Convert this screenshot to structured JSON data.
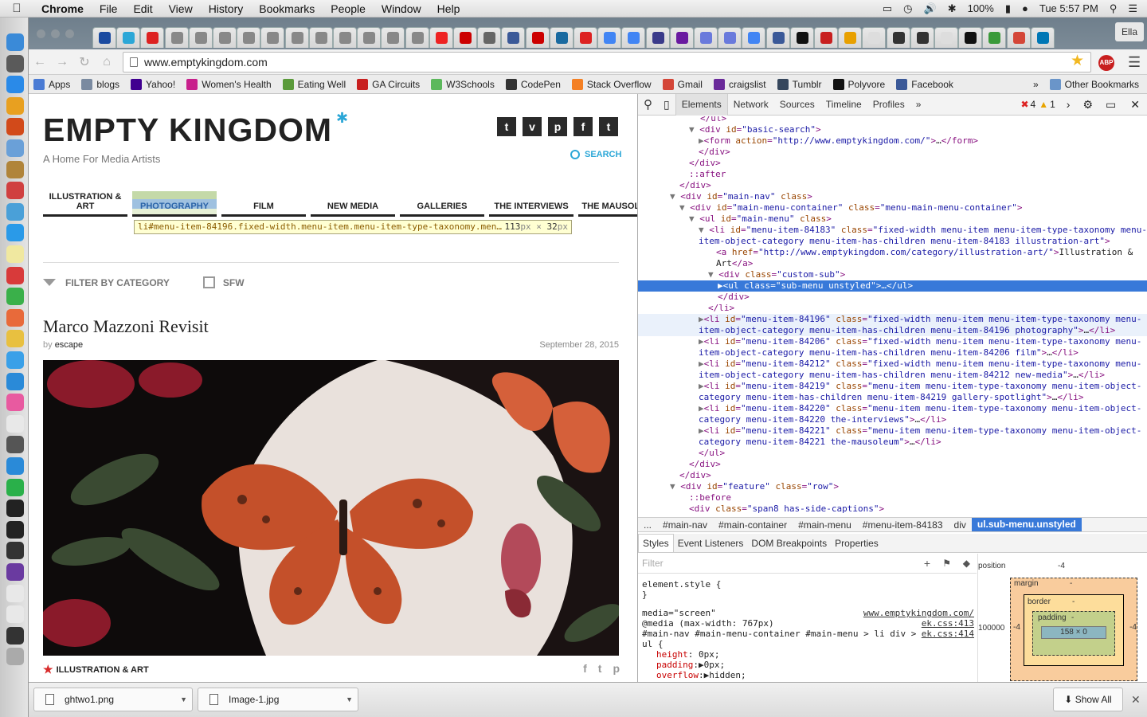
{
  "menubar": {
    "app": "Chrome",
    "items": [
      "File",
      "Edit",
      "View",
      "History",
      "Bookmarks",
      "People",
      "Window",
      "Help"
    ],
    "battery": "100%",
    "clock": "Tue 5:57 PM"
  },
  "browser": {
    "profile": "Ella",
    "url": "www.emptykingdom.com",
    "abp": "ABP",
    "bookmarks": [
      {
        "label": "Apps",
        "color": "#4a7bd4"
      },
      {
        "label": "blogs",
        "color": "#7a8aa0"
      },
      {
        "label": "Yahoo!",
        "color": "#400090"
      },
      {
        "label": "Women's Health",
        "color": "#c8208c"
      },
      {
        "label": "Eating Well",
        "color": "#5a9a3a"
      },
      {
        "label": "GA Circuits",
        "color": "#c82020"
      },
      {
        "label": "W3Schools",
        "color": "#5cb85c"
      },
      {
        "label": "CodePen",
        "color": "#333333"
      },
      {
        "label": "Stack Overflow",
        "color": "#f48024"
      },
      {
        "label": "Gmail",
        "color": "#d44638"
      },
      {
        "label": "craigslist",
        "color": "#6a2a9a"
      },
      {
        "label": "Tumblr",
        "color": "#35465c"
      },
      {
        "label": "Polyvore",
        "color": "#111111"
      },
      {
        "label": "Facebook",
        "color": "#3b5998"
      }
    ],
    "other_bookmarks": "Other Bookmarks",
    "more": "»"
  },
  "site": {
    "logo": "EMPTY KINGDOM",
    "tagline": "A Home For Media Artists",
    "search_label": "SEARCH",
    "social": [
      "t",
      "v",
      "p",
      "f",
      "t"
    ],
    "nav": [
      "ILLUSTRATION & ART",
      "PHOTOGRAPHY",
      "FILM",
      "NEW MEDIA",
      "GALLERIES",
      "THE INTERVIEWS",
      "THE MAUSOLEUM"
    ],
    "tooltip": {
      "id": "li#menu-item-84196",
      "cls": ".fixed-width.menu-item.menu-item-type-taxonomy.men…",
      "w": "113",
      "h": "32",
      "unit": "px",
      "times": "×"
    },
    "filter_label": "FILTER BY CATEGORY",
    "sfw_label": "SFW",
    "post": {
      "title": "Marco Mazzoni Revisit",
      "by": "by",
      "author": "escape",
      "date": "September 28, 2015",
      "category": "ILLUSTRATION & ART"
    },
    "share": [
      "f",
      "t",
      "p"
    ]
  },
  "devtools": {
    "tabs": [
      "Elements",
      "Network",
      "Sources",
      "Timeline",
      "Profiles"
    ],
    "active_tab": "Elements",
    "errors": "4",
    "warnings": "1",
    "breadcrumbs": [
      "...",
      "#main-nav",
      "#main-container",
      "#main-menu",
      "#menu-item-84183",
      "div",
      "ul.sub-menu.unstyled"
    ],
    "panel_tabs": [
      "Styles",
      "Event Listeners",
      "DOM Breakpoints",
      "Properties"
    ],
    "filter_placeholder": "Filter",
    "styles": {
      "element_style": "element.style {",
      "close": "}",
      "media": "media=\"screen\"",
      "media_query": "@media (max-width: 767px)",
      "selector": "#main-nav #main-menu-container #main-menu > li div >",
      "selector2": "ul {",
      "src1": "www.emptykingdom.com/",
      "src2": "ek.css:413",
      "src3": "ek.css:414",
      "props": [
        {
          "name": "height",
          "value": "0px;"
        },
        {
          "name": "padding",
          "value": "0px;"
        },
        {
          "name": "overflow",
          "value": "hidden;"
        }
      ]
    },
    "boxmodel": {
      "position": "position",
      "pos_val": "-4",
      "margin": "margin",
      "border": "border",
      "padding": "padding",
      "dash": "-",
      "content": "158 × 0",
      "left": "100000",
      "mleft": "-4",
      "mright": "-4"
    }
  },
  "downloads": {
    "items": [
      "ghtwo1.png",
      "Image-1.jpg"
    ],
    "show_all": "Show All"
  }
}
